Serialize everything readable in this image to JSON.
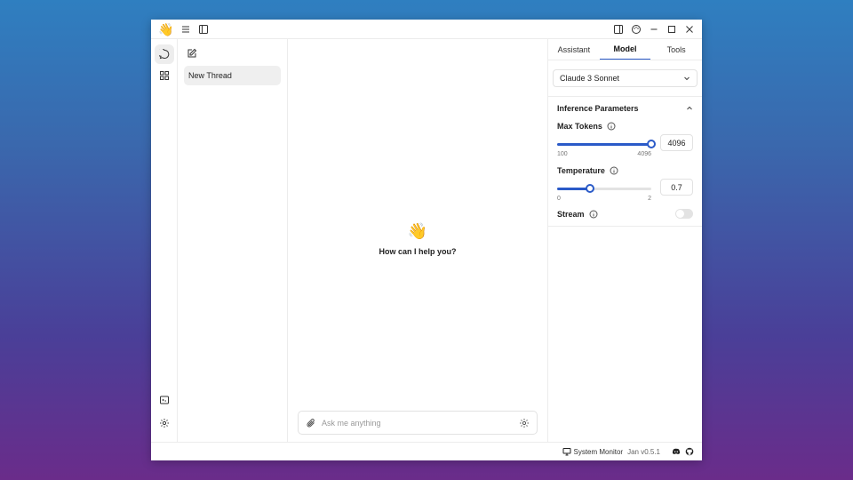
{
  "titlebar": {
    "logo_emoji": "👋",
    "icons": [
      "hamburger-icon",
      "sidebar-toggle-icon",
      "panel-toggle-icon",
      "palette-icon",
      "minimize-icon",
      "maximize-icon",
      "close-icon"
    ]
  },
  "rail": {
    "items": [
      "chat-icon",
      "hub-grid-icon"
    ],
    "bottom": [
      "api-server-icon",
      "settings-icon"
    ]
  },
  "threads": {
    "items": [
      {
        "label": "New Thread",
        "active": true
      }
    ]
  },
  "chat": {
    "welcome_emoji": "👋",
    "welcome_message": "How can I help you?",
    "input_placeholder": "Ask me anything"
  },
  "panel": {
    "tabs": [
      {
        "label": "Assistant",
        "active": false
      },
      {
        "label": "Model",
        "active": true
      },
      {
        "label": "Tools",
        "active": false
      }
    ],
    "model_selected": "Claude 3 Sonnet",
    "section_title": "Inference Parameters",
    "max_tokens": {
      "label": "Max Tokens",
      "value": "4096",
      "min": "100",
      "max": "4096",
      "fraction": 1.0
    },
    "temperature": {
      "label": "Temperature",
      "value": "0.7",
      "min": "0",
      "max": "2",
      "fraction": 0.35
    },
    "stream": {
      "label": "Stream",
      "enabled": false
    }
  },
  "status": {
    "system_monitor": "System Monitor",
    "version": "Jan v0.5.1"
  },
  "colors": {
    "accent": "#2a5ac8"
  }
}
